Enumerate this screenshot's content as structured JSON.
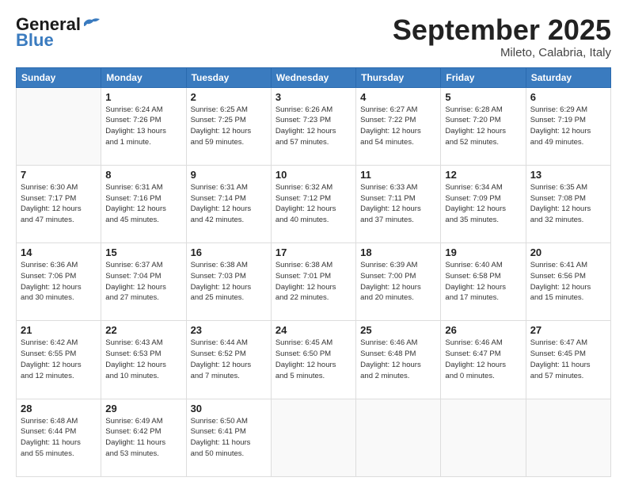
{
  "header": {
    "logo_line1": "General",
    "logo_line2": "Blue",
    "month_title": "September 2025",
    "subtitle": "Mileto, Calabria, Italy"
  },
  "days_of_week": [
    "Sunday",
    "Monday",
    "Tuesday",
    "Wednesday",
    "Thursday",
    "Friday",
    "Saturday"
  ],
  "weeks": [
    [
      {
        "day": "",
        "info": ""
      },
      {
        "day": "1",
        "info": "Sunrise: 6:24 AM\nSunset: 7:26 PM\nDaylight: 13 hours\nand 1 minute."
      },
      {
        "day": "2",
        "info": "Sunrise: 6:25 AM\nSunset: 7:25 PM\nDaylight: 12 hours\nand 59 minutes."
      },
      {
        "day": "3",
        "info": "Sunrise: 6:26 AM\nSunset: 7:23 PM\nDaylight: 12 hours\nand 57 minutes."
      },
      {
        "day": "4",
        "info": "Sunrise: 6:27 AM\nSunset: 7:22 PM\nDaylight: 12 hours\nand 54 minutes."
      },
      {
        "day": "5",
        "info": "Sunrise: 6:28 AM\nSunset: 7:20 PM\nDaylight: 12 hours\nand 52 minutes."
      },
      {
        "day": "6",
        "info": "Sunrise: 6:29 AM\nSunset: 7:19 PM\nDaylight: 12 hours\nand 49 minutes."
      }
    ],
    [
      {
        "day": "7",
        "info": "Sunrise: 6:30 AM\nSunset: 7:17 PM\nDaylight: 12 hours\nand 47 minutes."
      },
      {
        "day": "8",
        "info": "Sunrise: 6:31 AM\nSunset: 7:16 PM\nDaylight: 12 hours\nand 45 minutes."
      },
      {
        "day": "9",
        "info": "Sunrise: 6:31 AM\nSunset: 7:14 PM\nDaylight: 12 hours\nand 42 minutes."
      },
      {
        "day": "10",
        "info": "Sunrise: 6:32 AM\nSunset: 7:12 PM\nDaylight: 12 hours\nand 40 minutes."
      },
      {
        "day": "11",
        "info": "Sunrise: 6:33 AM\nSunset: 7:11 PM\nDaylight: 12 hours\nand 37 minutes."
      },
      {
        "day": "12",
        "info": "Sunrise: 6:34 AM\nSunset: 7:09 PM\nDaylight: 12 hours\nand 35 minutes."
      },
      {
        "day": "13",
        "info": "Sunrise: 6:35 AM\nSunset: 7:08 PM\nDaylight: 12 hours\nand 32 minutes."
      }
    ],
    [
      {
        "day": "14",
        "info": "Sunrise: 6:36 AM\nSunset: 7:06 PM\nDaylight: 12 hours\nand 30 minutes."
      },
      {
        "day": "15",
        "info": "Sunrise: 6:37 AM\nSunset: 7:04 PM\nDaylight: 12 hours\nand 27 minutes."
      },
      {
        "day": "16",
        "info": "Sunrise: 6:38 AM\nSunset: 7:03 PM\nDaylight: 12 hours\nand 25 minutes."
      },
      {
        "day": "17",
        "info": "Sunrise: 6:38 AM\nSunset: 7:01 PM\nDaylight: 12 hours\nand 22 minutes."
      },
      {
        "day": "18",
        "info": "Sunrise: 6:39 AM\nSunset: 7:00 PM\nDaylight: 12 hours\nand 20 minutes."
      },
      {
        "day": "19",
        "info": "Sunrise: 6:40 AM\nSunset: 6:58 PM\nDaylight: 12 hours\nand 17 minutes."
      },
      {
        "day": "20",
        "info": "Sunrise: 6:41 AM\nSunset: 6:56 PM\nDaylight: 12 hours\nand 15 minutes."
      }
    ],
    [
      {
        "day": "21",
        "info": "Sunrise: 6:42 AM\nSunset: 6:55 PM\nDaylight: 12 hours\nand 12 minutes."
      },
      {
        "day": "22",
        "info": "Sunrise: 6:43 AM\nSunset: 6:53 PM\nDaylight: 12 hours\nand 10 minutes."
      },
      {
        "day": "23",
        "info": "Sunrise: 6:44 AM\nSunset: 6:52 PM\nDaylight: 12 hours\nand 7 minutes."
      },
      {
        "day": "24",
        "info": "Sunrise: 6:45 AM\nSunset: 6:50 PM\nDaylight: 12 hours\nand 5 minutes."
      },
      {
        "day": "25",
        "info": "Sunrise: 6:46 AM\nSunset: 6:48 PM\nDaylight: 12 hours\nand 2 minutes."
      },
      {
        "day": "26",
        "info": "Sunrise: 6:46 AM\nSunset: 6:47 PM\nDaylight: 12 hours\nand 0 minutes."
      },
      {
        "day": "27",
        "info": "Sunrise: 6:47 AM\nSunset: 6:45 PM\nDaylight: 11 hours\nand 57 minutes."
      }
    ],
    [
      {
        "day": "28",
        "info": "Sunrise: 6:48 AM\nSunset: 6:44 PM\nDaylight: 11 hours\nand 55 minutes."
      },
      {
        "day": "29",
        "info": "Sunrise: 6:49 AM\nSunset: 6:42 PM\nDaylight: 11 hours\nand 53 minutes."
      },
      {
        "day": "30",
        "info": "Sunrise: 6:50 AM\nSunset: 6:41 PM\nDaylight: 11 hours\nand 50 minutes."
      },
      {
        "day": "",
        "info": ""
      },
      {
        "day": "",
        "info": ""
      },
      {
        "day": "",
        "info": ""
      },
      {
        "day": "",
        "info": ""
      }
    ]
  ]
}
